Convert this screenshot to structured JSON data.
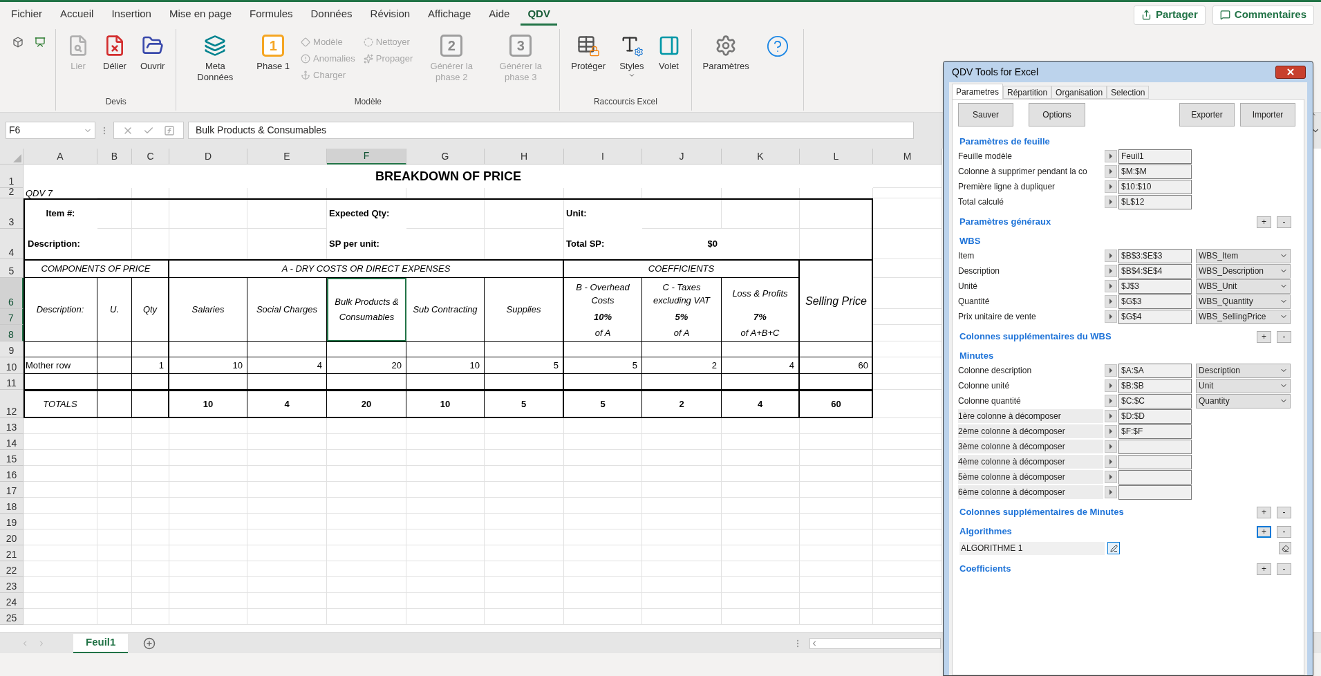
{
  "menu_tabs": [
    {
      "label": "Fichier",
      "selected": false
    },
    {
      "label": "Accueil",
      "selected": false
    },
    {
      "label": "Insertion",
      "selected": false
    },
    {
      "label": "Mise en page",
      "selected": false
    },
    {
      "label": "Formules",
      "selected": false
    },
    {
      "label": "Données",
      "selected": false
    },
    {
      "label": "Révision",
      "selected": false
    },
    {
      "label": "Affichage",
      "selected": false
    },
    {
      "label": "Aide",
      "selected": false
    },
    {
      "label": "QDV",
      "selected": true
    }
  ],
  "share_button": "Partager",
  "comments_button": "Commentaires",
  "ribbon_groups": [
    {
      "buttons": [
        {
          "kind": "tiny"
        },
        {
          "kind": "tiny"
        }
      ]
    },
    {
      "label": "Devis",
      "buttons": [
        {
          "kind": "large",
          "label": "Lier",
          "disabled": true
        },
        {
          "kind": "large",
          "label": "Délier",
          "disabled": false
        },
        {
          "kind": "large",
          "label": "Ouvrir",
          "disabled": false
        }
      ]
    },
    {
      "label": "Modèle",
      "buttons": [
        {
          "kind": "large",
          "label": "Meta Données",
          "disabled": false
        },
        {
          "kind": "large",
          "label": "Phase 1",
          "badge": "1",
          "disabled": false
        },
        {
          "kind": "small",
          "label": "Modèle",
          "disabled": true
        },
        {
          "kind": "small",
          "label": "Anomalies",
          "disabled": true
        },
        {
          "kind": "small",
          "label": "Charger",
          "disabled": true
        },
        {
          "kind": "small",
          "label": "Nettoyer",
          "disabled": true
        },
        {
          "kind": "small",
          "label": "Propager",
          "disabled": true
        },
        {
          "kind": "large",
          "label": "Générer la phase 2",
          "badge": "2",
          "disabled": true
        },
        {
          "kind": "large",
          "label": "Générer la phase 3",
          "badge": "3",
          "disabled": true
        }
      ]
    },
    {
      "label": "Raccourcis Excel",
      "buttons": [
        {
          "kind": "large",
          "label": "Protéger",
          "disabled": false
        },
        {
          "kind": "menu",
          "label": "Styles",
          "disabled": false
        },
        {
          "kind": "large",
          "label": "Volet",
          "disabled": false
        }
      ]
    },
    {
      "buttons": [
        {
          "kind": "large",
          "label": "Paramètres",
          "disabled": false
        },
        {
          "kind": "icon"
        }
      ]
    }
  ],
  "name_box": "F6",
  "formula": "Bulk Products & Consumables",
  "column_headers": [
    {
      "label": "A",
      "selected": false
    },
    {
      "label": "B",
      "selected": false
    },
    {
      "label": "C",
      "selected": false
    },
    {
      "label": "D",
      "selected": false
    },
    {
      "label": "E",
      "selected": false
    },
    {
      "label": "F",
      "selected": true
    },
    {
      "label": "G",
      "selected": false
    },
    {
      "label": "H",
      "selected": false
    },
    {
      "label": "I",
      "selected": false
    },
    {
      "label": "J",
      "selected": false
    },
    {
      "label": "K",
      "selected": false
    },
    {
      "label": "L",
      "selected": false
    },
    {
      "label": "M",
      "selected": false
    }
  ],
  "row_numbers": [
    {
      "label": "1",
      "selected": false
    },
    {
      "label": "2",
      "selected": false
    },
    {
      "label": "3",
      "selected": false
    },
    {
      "label": "4",
      "selected": false
    },
    {
      "label": "5",
      "selected": false
    },
    {
      "label": "6",
      "selected": true
    },
    {
      "label": "7",
      "selected": true
    },
    {
      "label": "8",
      "selected": true
    },
    {
      "label": "9",
      "selected": false
    },
    {
      "label": "10",
      "selected": false
    },
    {
      "label": "11",
      "selected": false
    },
    {
      "label": "12",
      "selected": false
    },
    {
      "label": "13",
      "selected": false
    },
    {
      "label": "14",
      "selected": false
    },
    {
      "label": "15",
      "selected": false
    },
    {
      "label": "16",
      "selected": false
    },
    {
      "label": "17",
      "selected": false
    },
    {
      "label": "18",
      "selected": false
    },
    {
      "label": "19",
      "selected": false
    },
    {
      "label": "20",
      "selected": false
    },
    {
      "label": "21",
      "selected": false
    },
    {
      "label": "22",
      "selected": false
    },
    {
      "label": "23",
      "selected": false
    },
    {
      "label": "24",
      "selected": false
    },
    {
      "label": "25",
      "selected": false
    }
  ],
  "sheet": {
    "title": "BREAKDOWN OF PRICE",
    "version": "QDV 7",
    "item_label": "Item #:",
    "description_label": "Description:",
    "expected_qty_label": "Expected Qty:",
    "sp_per_unit_label": "SP per unit:",
    "unit_label": "Unit:",
    "total_sp_label": "Total SP:",
    "total_sp_value": "$0",
    "group_headers": [
      "COMPONENTS OF PRICE",
      "A - DRY COSTS OR DIRECT EXPENSES",
      "COEFFICIENTS"
    ],
    "column_headers": [
      "Description:",
      "U.",
      "Qty",
      "Salaries",
      "Social Charges",
      "Bulk Products & Consumables",
      "Sub Contracting",
      "Supplies"
    ],
    "coefficients": [
      {
        "name": "B - Overhead Costs",
        "rate": "10%",
        "basis": "of A"
      },
      {
        "name": "C - Taxes excluding VAT",
        "rate": "5%",
        "basis": "of A"
      },
      {
        "name": "Loss & Profits",
        "rate": "7%",
        "basis": "of A+B+C"
      }
    ],
    "selling_price_header": "Selling Price",
    "mother_row": {
      "label": "Mother row",
      "qty": "1",
      "values": [
        "10",
        "4",
        "20",
        "10",
        "5",
        "5",
        "2",
        "4",
        "60"
      ]
    },
    "totals_row": {
      "label": "TOTALS",
      "values": [
        "10",
        "4",
        "20",
        "10",
        "5",
        "5",
        "2",
        "4",
        "60"
      ]
    }
  },
  "sheet_tabs": [
    {
      "label": "Feuil1",
      "selected": true
    }
  ],
  "panel": {
    "title": "QDV Tools for Excel",
    "tabs": [
      {
        "label": "Parametres",
        "selected": true
      },
      {
        "label": "Répartition",
        "selected": false
      },
      {
        "label": "Organisation",
        "selected": false
      },
      {
        "label": "Selection",
        "selected": false
      }
    ],
    "actions": [
      "Sauver",
      "Options",
      "Exporter",
      "Importer"
    ],
    "sections": [
      {
        "title": "Paramètres de feuille",
        "fields": [
          {
            "label": "Feuille modèle",
            "value": "Feuil1"
          },
          {
            "label": "Colonne à supprimer pendant la co",
            "value": "$M:$M"
          },
          {
            "label": "Première ligne à dupliquer",
            "value": "$10:$10"
          },
          {
            "label": "Total calculé",
            "value": "$L$12"
          }
        ]
      },
      {
        "title": "Paramètres généraux",
        "controls": [
          {
            "label": "+",
            "focused": false
          },
          {
            "label": "-",
            "focused": false
          }
        ]
      },
      {
        "title": "WBS",
        "fields": [
          {
            "label": "Item",
            "value": "$B$3:$E$3",
            "choice": "WBS_Item"
          },
          {
            "label": "Description",
            "value": "$B$4:$E$4",
            "choice": "WBS_Description"
          },
          {
            "label": "Unité",
            "value": "$J$3",
            "choice": "WBS_Unit"
          },
          {
            "label": "Quantité",
            "value": "$G$3",
            "choice": "WBS_Quantity"
          },
          {
            "label": "Prix unitaire de vente",
            "value": "$G$4",
            "choice": "WBS_SellingPrice"
          }
        ]
      },
      {
        "title": "Colonnes supplémentaires du WBS",
        "controls": [
          {
            "label": "+",
            "focused": false
          },
          {
            "label": "-",
            "focused": false
          }
        ]
      },
      {
        "title": "Minutes",
        "fields": [
          {
            "label": "Colonne description",
            "value": "$A:$A",
            "choice": "Description",
            "shaded": false
          },
          {
            "label": "Colonne unité",
            "value": "$B:$B",
            "choice": "Unit",
            "shaded": false
          },
          {
            "label": "Colonne quantité",
            "value": "$C:$C",
            "choice": "Quantity",
            "shaded": false
          },
          {
            "label": "1ère colonne à décomposer",
            "value": "$D:$D",
            "shaded": true
          },
          {
            "label": "2ème colonne à décomposer",
            "value": "$F:$F",
            "shaded": true
          },
          {
            "label": "3ème colonne à décomposer",
            "shaded": true
          },
          {
            "label": "4ème colonne à décomposer",
            "shaded": true
          },
          {
            "label": "5ème colonne à décomposer",
            "shaded": true
          },
          {
            "label": "6ème colonne à décomposer",
            "shaded": true
          }
        ]
      },
      {
        "title": "Colonnes supplémentaires de Minutes",
        "controls": [
          {
            "label": "+",
            "focused": false
          },
          {
            "label": "-",
            "focused": false
          }
        ]
      },
      {
        "title": "Algorithmes",
        "controls": [
          {
            "label": "+",
            "focused": true
          },
          {
            "label": "-",
            "focused": false
          }
        ],
        "algorithms": [
          {
            "label": "ALGORITHME 1"
          }
        ]
      },
      {
        "title": "Coefficients",
        "controls": [
          {
            "label": "+",
            "focused": false
          },
          {
            "label": "-",
            "focused": false
          }
        ]
      }
    ]
  }
}
